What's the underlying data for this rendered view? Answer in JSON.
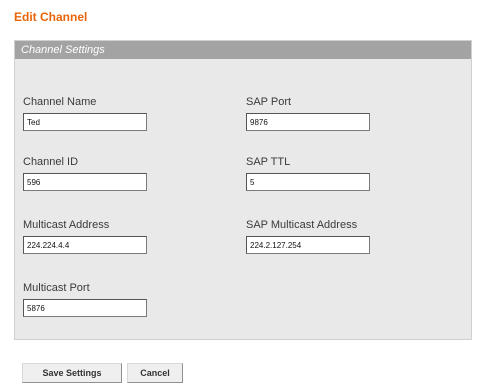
{
  "page": {
    "title": "Edit Channel"
  },
  "panel": {
    "header": "Channel Settings"
  },
  "fields": {
    "channel_name": {
      "label": "Channel Name",
      "value": "Ted"
    },
    "sap_port": {
      "label": "SAP Port",
      "value": "9876"
    },
    "channel_id": {
      "label": "Channel ID",
      "value": "596"
    },
    "sap_ttl": {
      "label": "SAP TTL",
      "value": "5"
    },
    "multicast_address": {
      "label": "Multicast Address",
      "value": "224.224.4.4"
    },
    "sap_multicast_address": {
      "label": "SAP Multicast Address",
      "value": "224.2.127.254"
    },
    "multicast_port": {
      "label": "Multicast Port",
      "value": "5876"
    }
  },
  "buttons": {
    "save": "Save Settings",
    "cancel": "Cancel"
  }
}
